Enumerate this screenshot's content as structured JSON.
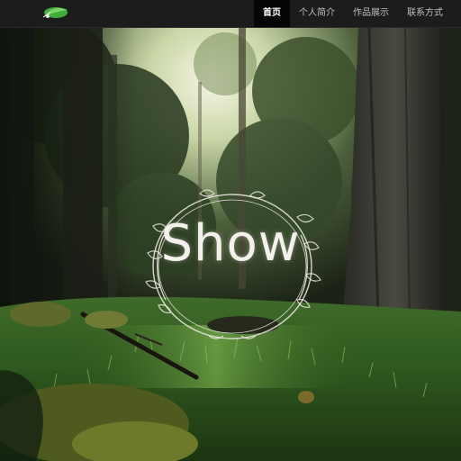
{
  "nav": {
    "items": [
      {
        "label": "首页",
        "active": true
      },
      {
        "label": "个人简介",
        "active": false
      },
      {
        "label": "作品展示",
        "active": false
      },
      {
        "label": "联系方式",
        "active": false
      }
    ]
  },
  "hero": {
    "title": "Show"
  },
  "colors": {
    "navbar_bg": "#1c1c1c",
    "nav_active_bg": "#050505",
    "logo_green": "#3fae3a"
  },
  "icons": {
    "logo": "leaf-logo-icon",
    "emblem": "wreath-icon"
  }
}
